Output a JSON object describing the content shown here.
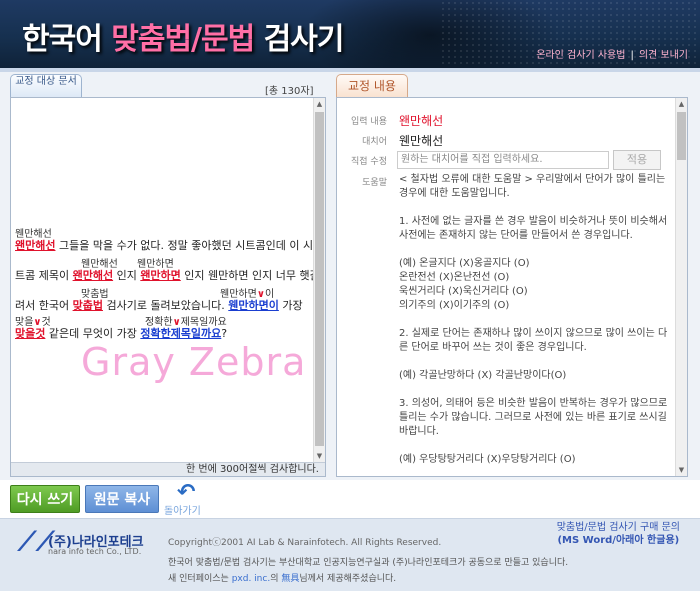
{
  "header": {
    "title_part1": "한국어 ",
    "title_part2": "맞춤법/문법",
    "title_part3": " 검사기",
    "link_usage": "온라인 검사기 사용법",
    "link_sep": "|",
    "link_feedback": "의견 보내기"
  },
  "left": {
    "tab_label": "교정 대상 문서",
    "char_count": "[총 130자]",
    "watermark": "Gray Zebra",
    "footer_note": "한 번에 300어절씩 검사합니다.",
    "lines": {
      "l1_ann": "웬만해선",
      "l1_err": "왠만해선",
      "l1_rest": " 그들을 막을 수가 없다. 정말 좋아했던 시트콤인데 이 시",
      "l2_ann1": "웬만해선",
      "l2_ann2": "웬만하면",
      "l2_pre": "트콤 제목이 ",
      "l2_err1": "왠만해선",
      "l2_mid1": " 인지 ",
      "l2_err2": "왠만하면",
      "l2_rest": " 인지 웬만하면 인지 너무 햇갈",
      "l3_ann1": "맞춤법",
      "l3_ann2": "웬만하면",
      "l3_ann3": "이",
      "l3_pre": "려서 한국어 ",
      "l3_err": "맞춥법",
      "l3_mid": " 검사기로 돌려보았습니다. ",
      "l3_sug": "웬만하면이",
      "l3_rest": " 가장",
      "l4_ann1": "맞을",
      "l4_ann2": "것",
      "l4_ann3": "정확한",
      "l4_ann4": "제목일까요",
      "l4_err": "맞을것",
      "l4_mid": " 같은데 무엇이 가장 ",
      "l4_sug": "정확한제목일까요",
      "l4_rest": "?"
    }
  },
  "right": {
    "tab_label": "교정 내용",
    "input_label": "입력 내용",
    "input_value": "왠만해선",
    "replace_label": "대치어",
    "replace_value": "웬만해선",
    "direct_label": "직접 수정",
    "direct_placeholder": "원하는 대치어를 직접 입력하세요.",
    "apply_label": "적용",
    "help_label": "도움말",
    "help": [
      "< 철자법 오류에 대한 도움말 > 우리말에서 단어가 많이 틀리는 경우에 대한 도움말입니다.",
      "1. 사전에 없는 글자를 쓴 경우 발음이 비슷하거나 뜻이 비슷해서 사전에는 존재하지 않는 단어를 만들어서 쓴 경우입니다.",
      "(예) 온글지다 (X)옹골지다 (O)\n온란전선 (X)온난전선 (O)\n욱씬거리다 (X)욱신거리다 (O)\n의기주의 (X)이기주의 (O)",
      "2. 실제로 단어는 존재하나 많이 쓰이지 않으므로 많이 쓰이는 다른 단어로 바꾸어 쓰는 것이 좋은 경우입니다.",
      "(예) 각골난망하다 (X) 각골난망이다(O)",
      "3. 의성어, 의태어 등은 비슷한 발음이 반복하는 경우가 많으므로 틀리는 수가 많습니다. 그러므로 사전에 있는 바른 표기로 쓰시길 바랍니다.",
      "(예) 우당탕탕거리다 (X)우당탕거리다 (O)"
    ]
  },
  "buttons": {
    "rewrite": "다시 쓰기",
    "copy": "원문 복사",
    "back": "돌아가기"
  },
  "footer": {
    "company": "(주)나라인포테크",
    "company_en": "nara info tech Co., LTD.",
    "copyright": "Copyrightⓒ2001 AI Lab & Narainfotech. All Rights Reserved.",
    "line2": "한국어 맞춤법/문법 검사기는 부산대학교 인공지능연구실과 (주)나라인포테크가 공동으로 만들고 있습니다.",
    "line3_pre": "새 인터페이스는 ",
    "line3_link1": "pxd. inc.",
    "line3_mid": "의 ",
    "line3_link2": "無具",
    "line3_post": "님께서 제공해주셨습니다.",
    "purchase1": "맞춤법/문법 검사기 구매 문의",
    "purchase2": "(MS Word/아래아 한글용)"
  },
  "colors": {
    "error": "#e0122c",
    "suggestion": "#1b3fd0",
    "header_bg": "#1f3a63",
    "accent_pink": "#ff6fa6"
  }
}
